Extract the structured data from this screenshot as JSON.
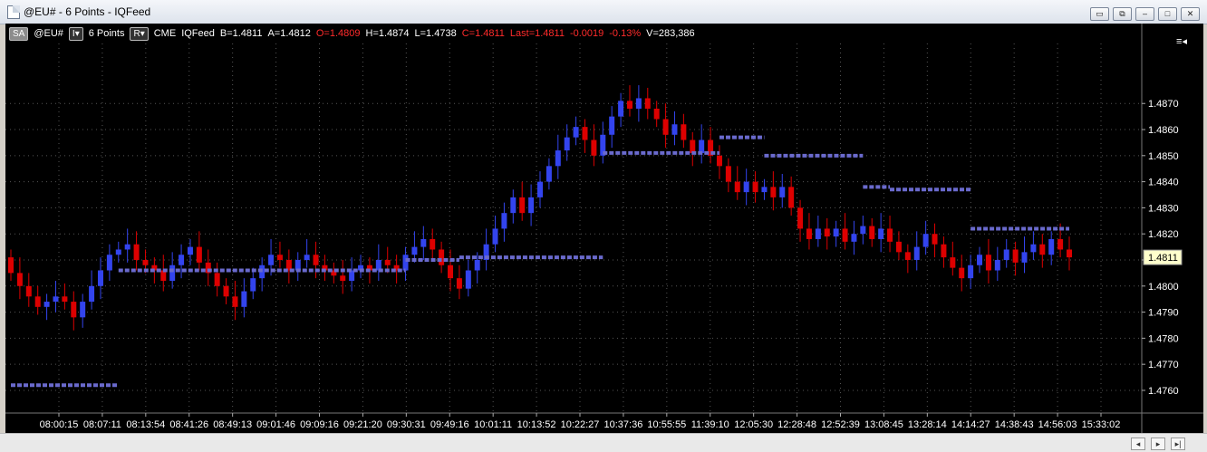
{
  "window": {
    "title": "@EU# - 6 Points - IQFeed",
    "buttons": [
      "▭",
      "⧉",
      "–",
      "□",
      "✕"
    ]
  },
  "toolbar": {
    "sa": "SA",
    "symbol": "@EU#",
    "interval_btn": "I▾",
    "interval": "6 Points",
    "r_btn": "R▾",
    "exchange": "CME",
    "feed": "IQFeed",
    "bid": "B=1.4811",
    "ask": "A=1.4812",
    "open": "O=1.4809",
    "high": "H=1.4874",
    "low": "L=1.4738",
    "close": "C=1.4811",
    "last": "Last=1.4811",
    "change": "-0.0019",
    "change_pct": "-0.13%",
    "volume": "V=283,386",
    "menu_icon": "≡◂"
  },
  "colors": {
    "up": "#3344ee",
    "down": "#dd0000",
    "level": "#6a6acd",
    "grid": "#555555",
    "last_bg": "#ffffcc"
  },
  "chart_data": {
    "type": "candlestick",
    "ylim": [
      1.4752,
      1.4893
    ],
    "y_ticks": [
      1.476,
      1.477,
      1.478,
      1.479,
      1.48,
      1.481,
      1.482,
      1.483,
      1.484,
      1.485,
      1.486,
      1.487
    ],
    "y_tick_labels": [
      "1.4760",
      "1.4770",
      "1.4780",
      "1.4790",
      "1.4800",
      "",
      "1.4820",
      "1.4830",
      "1.4840",
      "1.4850",
      "1.4860",
      "1.4870"
    ],
    "last_price": "1.4811",
    "last_value": 1.4811,
    "x_labels": [
      "08:00:15",
      "08:07:11",
      "08:13:54",
      "08:41:26",
      "08:49:13",
      "09:01:46",
      "09:09:16",
      "09:21:20",
      "09:30:31",
      "09:49:16",
      "10:01:11",
      "10:13:52",
      "10:22:27",
      "10:37:36",
      "10:55:55",
      "11:39:10",
      "12:05:30",
      "12:28:48",
      "12:52:39",
      "13:08:45",
      "13:28:14",
      "14:14:27",
      "14:38:43",
      "14:56:03",
      "15:33:02"
    ],
    "closes": [
      1.4805,
      1.48,
      1.4796,
      1.4792,
      1.4794,
      1.4796,
      1.4794,
      1.4788,
      1.4794,
      1.48,
      1.4806,
      1.4812,
      1.4814,
      1.4816,
      1.481,
      1.4808,
      1.4806,
      1.4802,
      1.4808,
      1.4812,
      1.4815,
      1.4809,
      1.4805,
      1.48,
      1.4796,
      1.4792,
      1.4798,
      1.4803,
      1.4808,
      1.4812,
      1.481,
      1.4806,
      1.481,
      1.4812,
      1.4808,
      1.4806,
      1.4804,
      1.4802,
      1.4806,
      1.4808,
      1.4806,
      1.481,
      1.4808,
      1.4806,
      1.4812,
      1.4815,
      1.4818,
      1.4814,
      1.4808,
      1.4803,
      1.4799,
      1.4806,
      1.481,
      1.4816,
      1.4822,
      1.4828,
      1.4834,
      1.4828,
      1.4834,
      1.484,
      1.4846,
      1.4852,
      1.4857,
      1.4861,
      1.4856,
      1.485,
      1.4858,
      1.4865,
      1.4871,
      1.4868,
      1.4872,
      1.4868,
      1.4864,
      1.4858,
      1.4862,
      1.4856,
      1.4851,
      1.4856,
      1.485,
      1.4846,
      1.484,
      1.4836,
      1.484,
      1.4836,
      1.4838,
      1.4834,
      1.4838,
      1.483,
      1.4822,
      1.4818,
      1.4822,
      1.4819,
      1.4822,
      1.4817,
      1.482,
      1.4823,
      1.4818,
      1.4822,
      1.4817,
      1.4813,
      1.481,
      1.4815,
      1.482,
      1.4816,
      1.4811,
      1.4807,
      1.4803,
      1.4808,
      1.4812,
      1.4806,
      1.481,
      1.4814,
      1.4809,
      1.4813,
      1.4816,
      1.4812,
      1.4818,
      1.4814,
      1.4811
    ],
    "levels": [
      {
        "price": 1.4762,
        "from": 0,
        "to": 12
      },
      {
        "price": 1.4806,
        "from": 12,
        "to": 44
      },
      {
        "price": 1.481,
        "from": 44,
        "to": 50
      },
      {
        "price": 1.4811,
        "from": 50,
        "to": 66
      },
      {
        "price": 1.4851,
        "from": 66,
        "to": 79
      },
      {
        "price": 1.4857,
        "from": 79,
        "to": 84
      },
      {
        "price": 1.485,
        "from": 84,
        "to": 95
      },
      {
        "price": 1.4838,
        "from": 95,
        "to": 98
      },
      {
        "price": 1.4837,
        "from": 98,
        "to": 107
      },
      {
        "price": 1.4822,
        "from": 107,
        "to": 118
      }
    ]
  }
}
